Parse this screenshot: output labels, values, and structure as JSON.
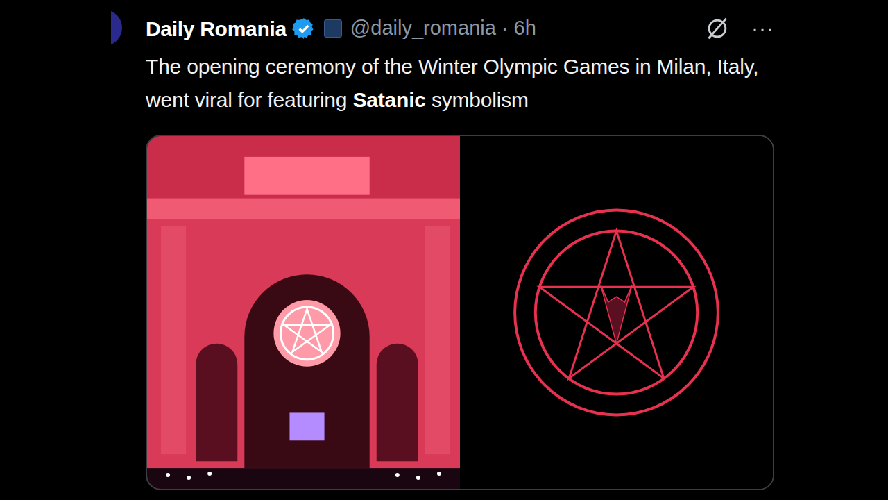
{
  "post": {
    "author": "Daily Romania",
    "handle": "@daily_romania",
    "separator": "·",
    "time": "6h",
    "menu": "···",
    "text": [
      {
        "text": "The opening ceremony of the Winter Olympic Games in Milan, Italy, went viral for featuring ",
        "bold": false
      },
      {
        "text": "Satanic",
        "bold": true
      },
      {
        "text": " symbolism",
        "bold": false
      }
    ],
    "media": [
      {
        "kind": "video"
      },
      {
        "kind": "graphic"
      }
    ]
  }
}
